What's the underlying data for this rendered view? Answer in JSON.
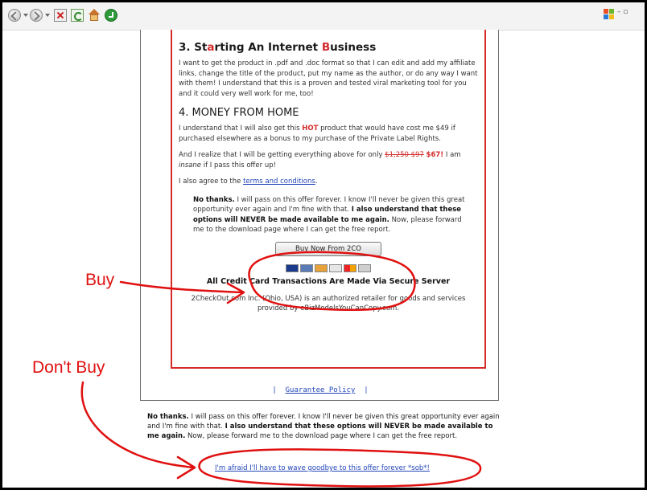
{
  "section3": {
    "number": "3.",
    "title_pre": "St",
    "title_red1": "a",
    "title_mid": "rting An Internet ",
    "title_red2": "B",
    "title_post": "usiness",
    "text": "I want to get the product in .pdf and .doc format so that I can edit and add my affiliate links, change the title of the product, put my name as the author, or do any way I want with them! I understand that this is a proven and tested viral marketing tool for you and it could very well work for me, too!"
  },
  "section4": {
    "title": "4. MONEY FROM HOME",
    "p1_a": "I understand that I will also get this ",
    "p1_hot": "HOT",
    "p1_b": " product that would have cost me $49 if purchased elsewhere as a bonus to my purchase of the Private Label Rights.",
    "p2_a": "And I realize that I will be getting everything above for only ",
    "p2_strike": "$1,250 $97",
    "p2_price": "$67!",
    "p2_b": " I am ",
    "p2_italic": "insane",
    "p2_c": " if I pass this offer up!",
    "p3_a": "I also agree to the ",
    "p3_link": "terms and conditions",
    "p3_b": "."
  },
  "nothanks_box": {
    "bold1": "No thanks.",
    "text1": " I will pass on this offer forever. I know I'll never be given this great opportunity ever again and I'm fine with that. ",
    "bold2": "I also understand that these options will NEVER be made available to me again.",
    "text2": " Now, please forward me to the download page where I can get the free report."
  },
  "buy_button": "Buy Now From 2CO",
  "secure": "All Credit Card Transactions Are Made Via Secure Server",
  "retailer": "2CheckOut.com Inc. (Ohio, USA) is an authorized retailer for goods and services provided by eBizModelsYouCanCopy.com.",
  "guarantee": {
    "sep": "|",
    "label": "Guarantee Policy"
  },
  "below": {
    "bold1": "No thanks.",
    "text1": " I will pass on this offer forever. I know I'll never be given this great opportunity ever again and I'm fine with that. ",
    "bold2": "I also understand that these options will NEVER be made available to me again.",
    "text2": " Now, please forward me to the download page where I can get the free report."
  },
  "goodbye_link": "I'm afraid I'll have to wave goodbye to this offer forever *sob*!",
  "annotations": {
    "buy": "Buy",
    "dont_buy": "Don't Buy"
  },
  "colors": {
    "annotation": "#e01010",
    "offer_border": "#d42b2b",
    "link": "#2246b8"
  },
  "toolbar_icons": [
    "back-icon",
    "forward-icon",
    "stop-icon",
    "refresh-icon",
    "home-icon",
    "history-icon"
  ]
}
